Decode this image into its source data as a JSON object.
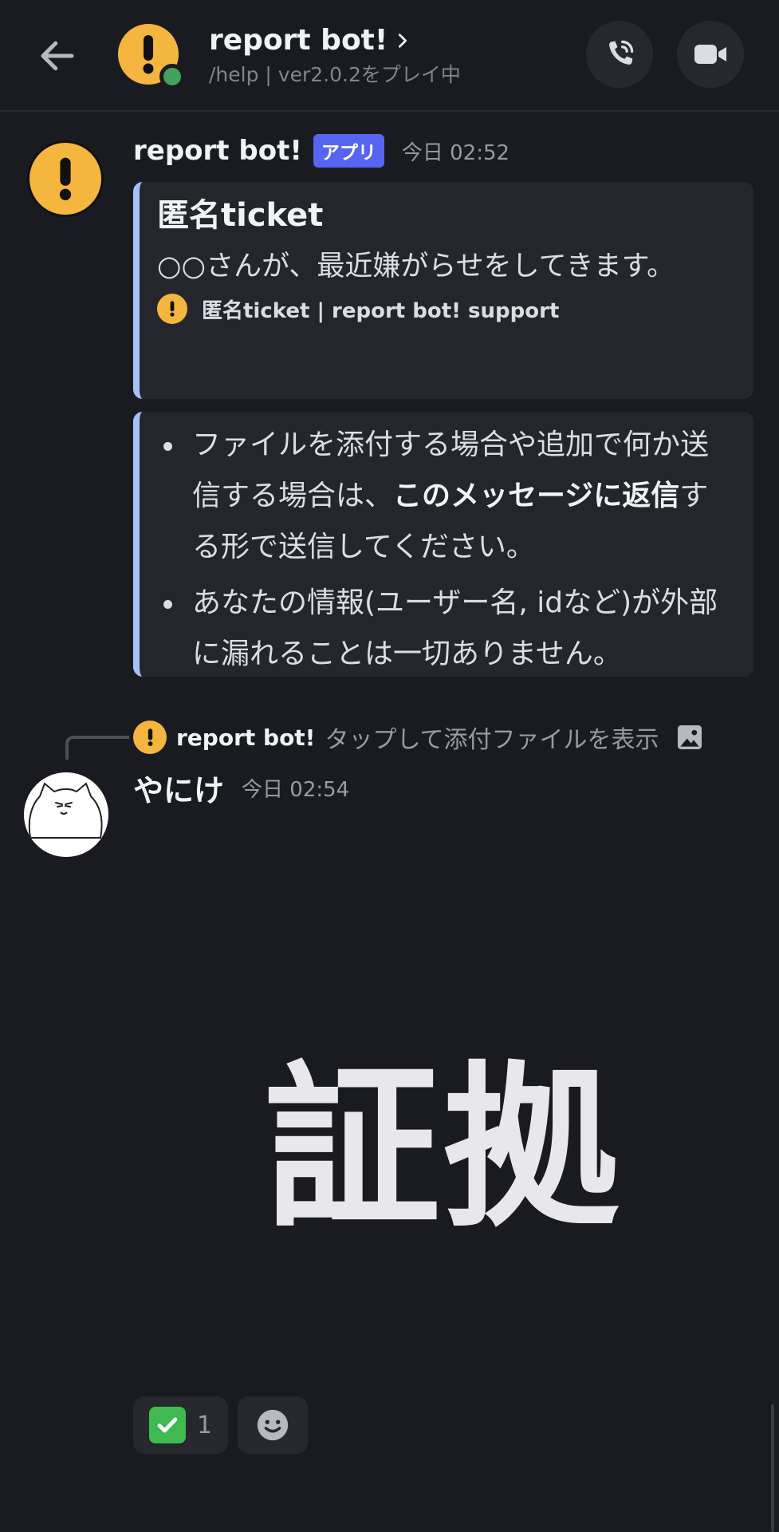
{
  "header": {
    "title": "report bot!",
    "subtitle": "/help | ver2.0.2をプレイ中"
  },
  "message1": {
    "author": "report bot!",
    "badge": "アプリ",
    "timestamp": "今日 02:52",
    "embed1": {
      "title": "匿名ticket",
      "description": "○○さんが、最近嫌がらせをしてきます。",
      "footer": "匿名ticket | report bot! support"
    },
    "embed2": {
      "item1_part1": "ファイルを添付する場合や追加で何か送信する場合は、",
      "item1_bold": "このメッセージに返信",
      "item1_part2": "する形で送信してください。",
      "item2": "あなたの情報(ユーザー名, idなど)が外部に漏れることは一切ありません。"
    }
  },
  "reply": {
    "author": "report bot!",
    "content": "タップして添付ファイルを表示"
  },
  "message2": {
    "author": "やにけ",
    "timestamp": "今日 02:54",
    "attachment_text": "証拠"
  },
  "reactions": [
    {
      "emoji": "white-check-mark",
      "count": "1"
    }
  ],
  "colors": {
    "background": "#1a1b20",
    "embed_border": "#a3c1f7",
    "app_badge": "#5865f2",
    "bot_avatar": "#f4b63f",
    "online": "#43a25a"
  }
}
